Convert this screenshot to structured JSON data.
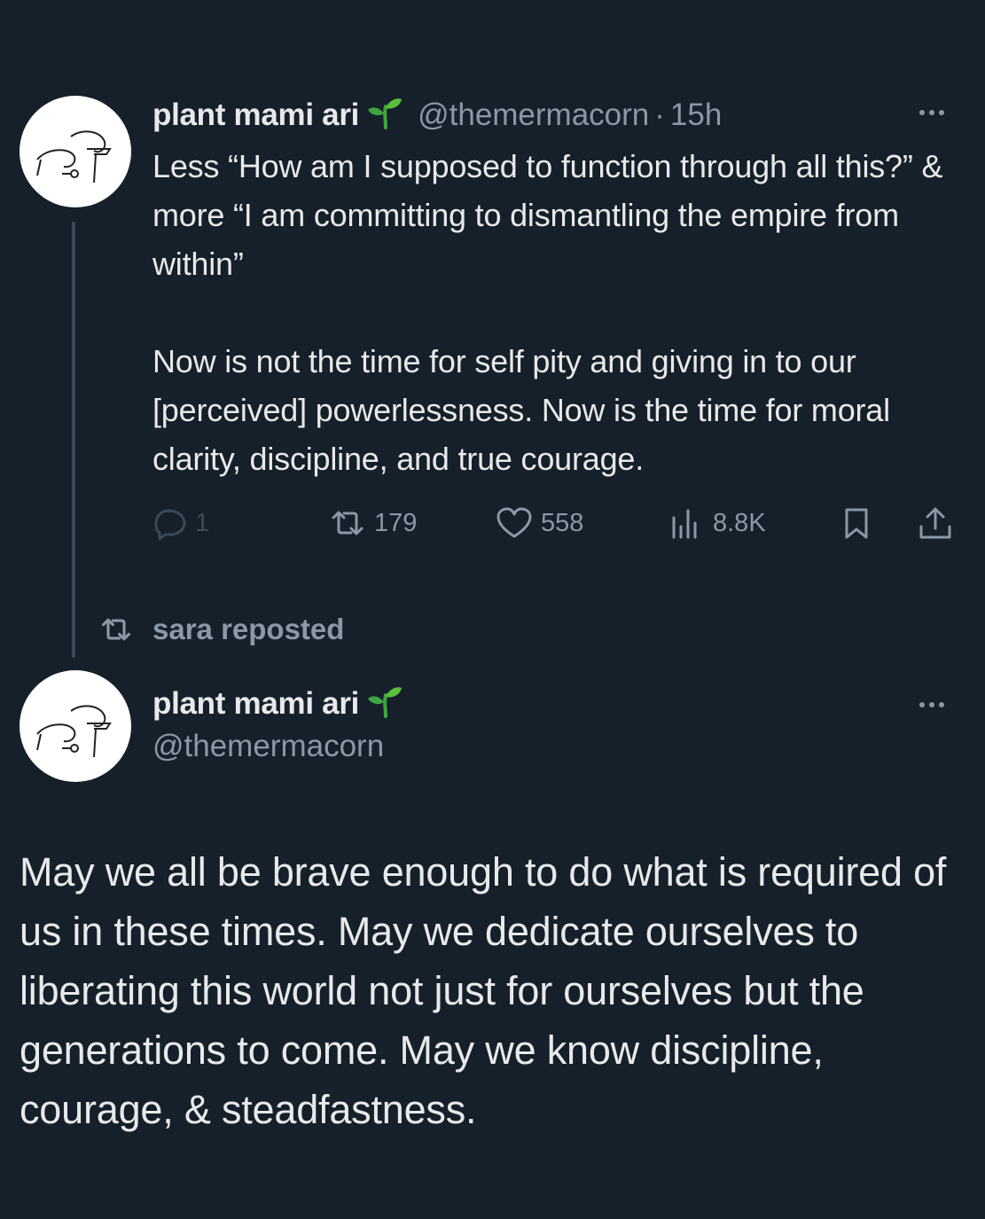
{
  "colors": {
    "background": "#15202b",
    "text_primary": "#e7e9ea",
    "text_secondary": "#8b98a5",
    "sprout_green": "#3fa53f"
  },
  "reply_tweet": {
    "author_name": "plant mami ari",
    "verified_emoji": "seedling",
    "handle": "@themermacorn",
    "separator": "·",
    "time": "15h",
    "more_icon": "ellipsis-icon",
    "text_paragraphs": [
      "Less “How am I supposed to function through all this?” & more “I am committing to dismantling the empire from within”",
      "Now is not the time for self pity and giving in to our [perceived] powerlessness. Now is the time for moral clarity, discipline, and true courage."
    ],
    "stats": {
      "replies": "1",
      "reposts": "179",
      "likes": "558",
      "views": "8.8K"
    }
  },
  "repost_banner": {
    "text": "sara reposted"
  },
  "main_tweet": {
    "author_name": "plant mami ari",
    "verified_emoji": "seedling",
    "handle": "@themermacorn",
    "more_icon": "ellipsis-icon",
    "text": "May we all be brave enough to do what is required of us in these times. May we dedicate ourselves to liberating this world not just for ourselves but the generations to come. May we know discipline, courage, & steadfastness."
  }
}
